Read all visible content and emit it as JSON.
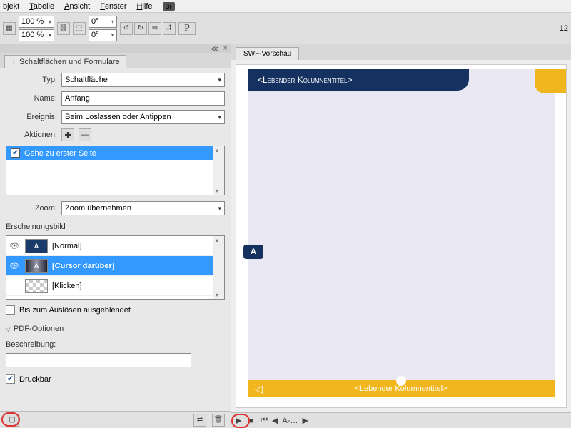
{
  "menu": {
    "bjekt": "bjekt",
    "tabelle": "Tabelle",
    "ansicht": "Ansicht",
    "fenster": "Fenster",
    "hilfe": "Hilfe",
    "br": "Br"
  },
  "toolbar": {
    "zoom1": "100 %",
    "zoom2": "100 %",
    "deg1": "0°",
    "deg2": "0°",
    "right_num": "12"
  },
  "panel": {
    "title": "Schaltflächen und Formulare",
    "typ_label": "Typ:",
    "typ_value": "Schaltfläche",
    "name_label": "Name:",
    "name_value": "Anfang",
    "ereignis_label": "Ereignis:",
    "ereignis_value": "Beim Loslassen oder Antippen",
    "aktionen_label": "Aktionen:",
    "action_item": "Gehe zu erster Seite",
    "zoom_label": "Zoom:",
    "zoom_value": "Zoom übernehmen",
    "erscheinung": "Erscheinungsbild",
    "states": {
      "normal": "[Normal]",
      "hover": "[Cursor darüber]",
      "click": "[Klicken]"
    },
    "hide_check": "Bis zum Auslösen ausgeblendet",
    "pdf_opt": "PDF-Optionen",
    "beschreibung": "Beschreibung:",
    "druckbar": "Druckbar",
    "badge": "A"
  },
  "preview": {
    "tab": "SWF-Vorschau",
    "header": "<Lebender Kolumnentitel>",
    "side": "A",
    "footer": "<Lebender Kolumnentitel>",
    "page_nav": "A-…"
  }
}
